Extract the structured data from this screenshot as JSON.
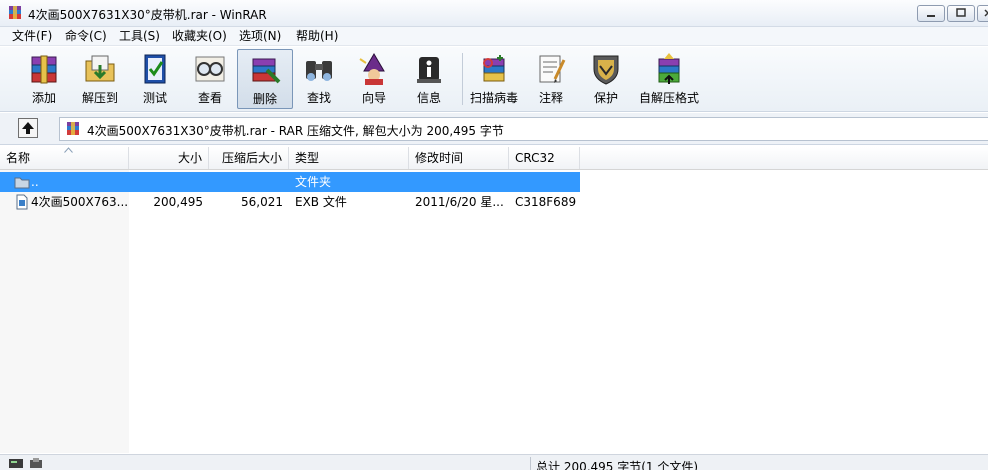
{
  "window": {
    "title": "4次画500X7631X30°皮带机.rar - WinRAR"
  },
  "menu": [
    {
      "label": "文件(F)"
    },
    {
      "label": "命令(C)"
    },
    {
      "label": "工具(S)"
    },
    {
      "label": "收藏夹(O)"
    },
    {
      "label": "选项(N)"
    },
    {
      "label": "帮助(H)"
    }
  ],
  "toolbar": [
    {
      "label": "添加",
      "icon": "books-add-icon"
    },
    {
      "label": "解压到",
      "icon": "folder-extract-icon"
    },
    {
      "label": "测试",
      "icon": "test-check-icon"
    },
    {
      "label": "查看",
      "icon": "view-glasses-icon"
    },
    {
      "label": "删除",
      "icon": "delete-icon"
    },
    {
      "label": "查找",
      "icon": "binoculars-icon"
    },
    {
      "label": "向导",
      "icon": "wizard-icon"
    },
    {
      "label": "信息",
      "icon": "info-icon"
    },
    {
      "label": "扫描病毒",
      "icon": "scan-virus-icon"
    },
    {
      "label": "注释",
      "icon": "comment-icon"
    },
    {
      "label": "保护",
      "icon": "protect-shield-icon"
    },
    {
      "label": "自解压格式",
      "icon": "sfx-icon"
    }
  ],
  "address": {
    "text": "4次画500X7631X30°皮带机.rar - RAR 压缩文件, 解包大小为 200,495 字节"
  },
  "columns": [
    {
      "label": "名称"
    },
    {
      "label": "大小"
    },
    {
      "label": "压缩后大小"
    },
    {
      "label": "类型"
    },
    {
      "label": "修改时间"
    },
    {
      "label": "CRC32"
    }
  ],
  "rows": [
    {
      "name": "..",
      "size": "",
      "packed": "",
      "type": "文件夹",
      "modified": "",
      "crc": "",
      "selected": true
    },
    {
      "name": "4次画500X763...",
      "size": "200,495",
      "packed": "56,021",
      "type": "EXB 文件",
      "modified": "2011/6/20 星...",
      "crc": "C318F689",
      "selected": false
    }
  ],
  "status": {
    "text": "总计 200,495 字节(1 个文件)"
  },
  "colors": {
    "selection": "#3399ff",
    "accent": "#6f8fb8"
  }
}
